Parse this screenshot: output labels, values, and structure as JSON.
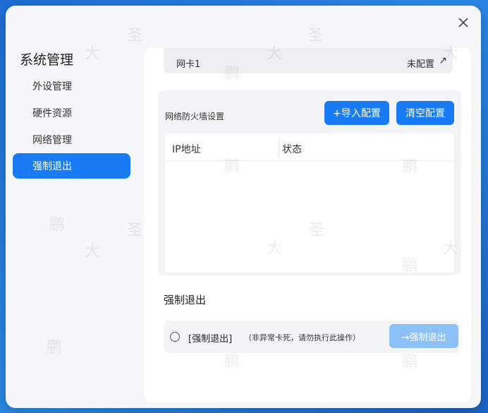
{
  "dialog": {
    "close_icon": "close-icon"
  },
  "sidebar": {
    "title": "系统管理",
    "items": [
      {
        "label": "外设管理"
      },
      {
        "label": "硬件资源"
      },
      {
        "label": "网络管理"
      },
      {
        "label": "强制退出",
        "active": true
      }
    ]
  },
  "network": {
    "nic_name": "网卡1",
    "nic_status": "未配置",
    "nic_arrow": "↗",
    "firewall_label": "网络防火墙设置",
    "import_btn": "+导入配置",
    "clear_btn": "清空配置",
    "table_headers": [
      "IP地址",
      "状态"
    ]
  },
  "force_quit": {
    "title": "强制退出",
    "option_label": "[强制退出]",
    "option_note": "（非异常卡死，请勿执行此操作）",
    "button_label": "→强制退出"
  },
  "watermark": {
    "text": [
      "鹏",
      "大",
      "圣"
    ]
  },
  "colors": {
    "accent": "#1a7cf5",
    "disabled_accent": "#8cc1f8",
    "background": "#2b8be8"
  }
}
